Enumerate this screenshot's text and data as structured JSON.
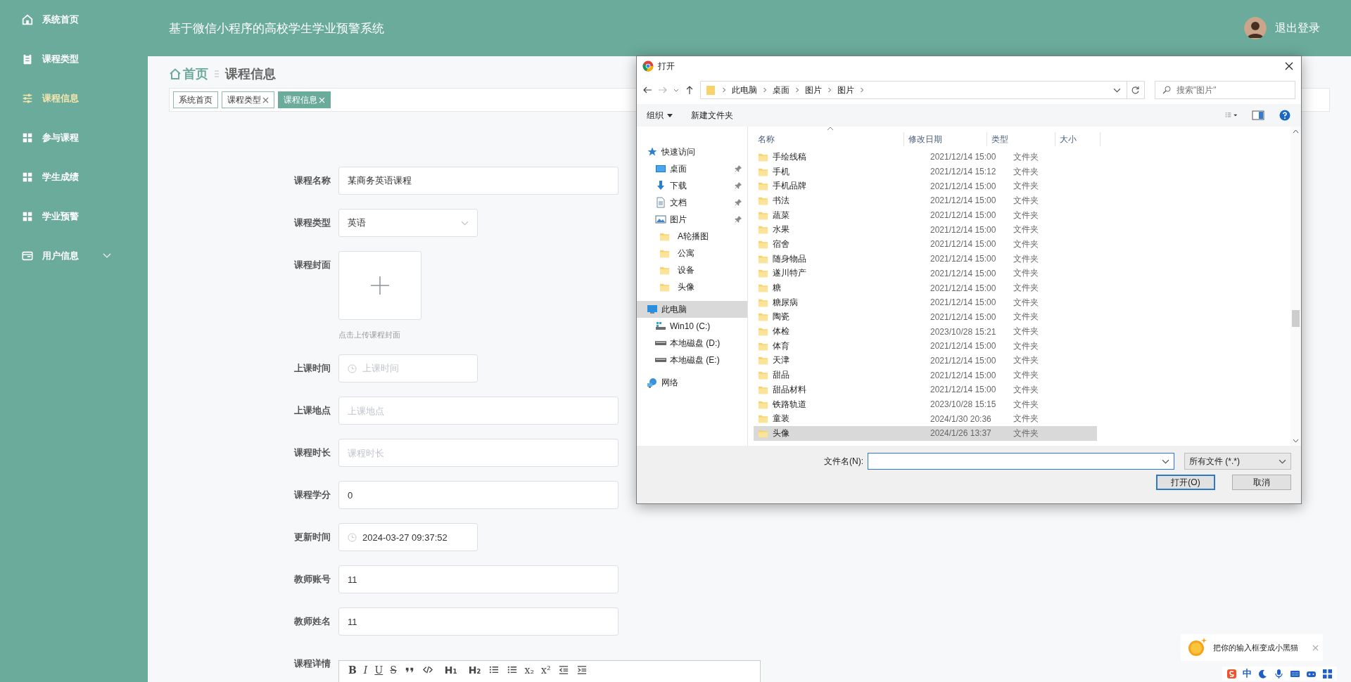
{
  "sidebar": {
    "items": [
      {
        "kind": "home",
        "label": "系统首页",
        "selected": false
      },
      {
        "kind": "clipboard",
        "label": "课程类型",
        "selected": false
      },
      {
        "kind": "sliders",
        "label": "课程信息",
        "selected": true
      },
      {
        "kind": "grid",
        "label": "参与课程",
        "selected": false
      },
      {
        "kind": "grid",
        "label": "学生成绩",
        "selected": false
      },
      {
        "kind": "grid",
        "label": "学业预警",
        "selected": false
      },
      {
        "kind": "card",
        "label": "用户信息",
        "selected": false,
        "expanded": false
      }
    ]
  },
  "header": {
    "title": "基于微信小程序的高校学生学业预警系统",
    "logout": "退出登录"
  },
  "breadcrumb": {
    "home": "首页",
    "current": "课程信息"
  },
  "tags": [
    {
      "label": "系统首页",
      "closable": false,
      "selected": false
    },
    {
      "label": "课程类型",
      "closable": true,
      "selected": false
    },
    {
      "label": "课程信息",
      "closable": true,
      "selected": true
    }
  ],
  "form": {
    "fields": [
      {
        "kind": "text",
        "label": "课程名称",
        "value": "某商务英语课程"
      },
      {
        "kind": "select",
        "label": "课程类型",
        "value": "英语"
      },
      {
        "kind": "upload",
        "label": "课程封面",
        "hint": "点击上传课程封面"
      },
      {
        "kind": "date",
        "label": "上课时间",
        "placeholder": "上课时间"
      },
      {
        "kind": "text",
        "label": "上课地点",
        "placeholder": "上课地点"
      },
      {
        "kind": "text",
        "label": "课程时长",
        "placeholder": "课程时长"
      },
      {
        "kind": "text",
        "label": "课程学分",
        "value": "0"
      },
      {
        "kind": "date",
        "label": "更新时间",
        "value": "2024-03-27 09:37:52"
      },
      {
        "kind": "text",
        "label": "教师账号",
        "value": "11"
      },
      {
        "kind": "text",
        "label": "教师姓名",
        "value": "11"
      },
      {
        "kind": "editor",
        "label": "课程详情",
        "toolbar": [
          {
            "kind": "bold",
            "label": "B"
          },
          {
            "kind": "italic",
            "label": "I"
          },
          {
            "kind": "underline",
            "label": "U"
          },
          {
            "kind": "strike",
            "label": "S"
          },
          {
            "kind": "quote"
          },
          {
            "kind": "code"
          },
          {
            "kind": "header",
            "label": "H₁"
          },
          {
            "kind": "header",
            "label": "H₂"
          },
          {
            "kind": "ordered-list"
          },
          {
            "kind": "bullet-list"
          },
          {
            "kind": "script",
            "label": "x₂"
          },
          {
            "kind": "script",
            "label": "x²"
          },
          {
            "kind": "outdent"
          },
          {
            "kind": "indent"
          }
        ]
      }
    ]
  },
  "file_dialog": {
    "title": "打开",
    "path": [
      "此电脑",
      "桌面",
      "图片",
      "图片"
    ],
    "search": {
      "placeholder": "搜索\"图片\""
    },
    "organize": "组织",
    "new_folder": "新建文件夹",
    "nav": [
      {
        "kind": "star",
        "label": "快速访问",
        "selected": false,
        "children": [
          {
            "kind": "desktop",
            "label": "桌面",
            "pinned": true,
            "selected": false
          },
          {
            "kind": "download",
            "label": "下载",
            "pinned": true,
            "selected": false
          },
          {
            "kind": "document",
            "label": "文档",
            "pinned": true,
            "selected": false
          },
          {
            "kind": "pictures",
            "label": "图片",
            "pinned": true,
            "selected": false
          },
          {
            "kind": "folder",
            "label": "A轮播图",
            "pinned": false,
            "selected": false
          },
          {
            "kind": "folder",
            "label": "公寓",
            "pinned": false,
            "selected": false
          },
          {
            "kind": "folder",
            "label": "设备",
            "pinned": false,
            "selected": false
          },
          {
            "kind": "folder",
            "label": "头像",
            "pinned": false,
            "selected": false
          }
        ]
      },
      {
        "kind": "computer",
        "label": "此电脑",
        "selected": true,
        "children": [
          {
            "kind": "system-drive",
            "label": "Win10 (C:)",
            "selected": false
          },
          {
            "kind": "drive",
            "label": "本地磁盘 (D:)",
            "selected": false
          },
          {
            "kind": "drive",
            "label": "本地磁盘 (E:)",
            "selected": false
          }
        ]
      },
      {
        "kind": "network",
        "label": "网络",
        "selected": false
      }
    ],
    "columns": [
      "名称",
      "修改日期",
      "类型",
      "大小"
    ],
    "rows": [
      {
        "name": "手绘线稿",
        "date": "2021/12/14 15:00",
        "type": "文件夹",
        "selected": false
      },
      {
        "name": "手机",
        "date": "2021/12/14 15:12",
        "type": "文件夹",
        "selected": false
      },
      {
        "name": "手机品牌",
        "date": "2021/12/14 15:00",
        "type": "文件夹",
        "selected": false
      },
      {
        "name": "书法",
        "date": "2021/12/14 15:00",
        "type": "文件夹",
        "selected": false
      },
      {
        "name": "蔬菜",
        "date": "2021/12/14 15:00",
        "type": "文件夹",
        "selected": false
      },
      {
        "name": "水果",
        "date": "2021/12/14 15:00",
        "type": "文件夹",
        "selected": false
      },
      {
        "name": "宿舍",
        "date": "2021/12/14 15:00",
        "type": "文件夹",
        "selected": false
      },
      {
        "name": "随身物品",
        "date": "2021/12/14 15:00",
        "type": "文件夹",
        "selected": false
      },
      {
        "name": "遂川特产",
        "date": "2021/12/14 15:00",
        "type": "文件夹",
        "selected": false
      },
      {
        "name": "糖",
        "date": "2021/12/14 15:00",
        "type": "文件夹",
        "selected": false
      },
      {
        "name": "糖尿病",
        "date": "2021/12/14 15:00",
        "type": "文件夹",
        "selected": false
      },
      {
        "name": "陶瓷",
        "date": "2021/12/14 15:00",
        "type": "文件夹",
        "selected": false
      },
      {
        "name": "体检",
        "date": "2023/10/28 15:21",
        "type": "文件夹",
        "selected": false
      },
      {
        "name": "体育",
        "date": "2021/12/14 15:00",
        "type": "文件夹",
        "selected": false
      },
      {
        "name": "天津",
        "date": "2021/12/14 15:00",
        "type": "文件夹",
        "selected": false
      },
      {
        "name": "甜品",
        "date": "2021/12/14 15:00",
        "type": "文件夹",
        "selected": false
      },
      {
        "name": "甜品材料",
        "date": "2021/12/14 15:00",
        "type": "文件夹",
        "selected": false
      },
      {
        "name": "铁路轨道",
        "date": "2023/10/28 15:15",
        "type": "文件夹",
        "selected": false
      },
      {
        "name": "童装",
        "date": "2024/1/30 20:36",
        "type": "文件夹",
        "selected": false
      },
      {
        "name": "头像",
        "date": "2024/1/26 13:37",
        "type": "文件夹",
        "selected": true
      }
    ],
    "filename_label": "文件名(N):",
    "filter": "所有文件 (*.*)",
    "buttons": [
      {
        "label": "打开(O)",
        "default": true
      },
      {
        "label": "取消",
        "default": false
      }
    ]
  },
  "ime": {
    "tip": "把你的输入框变成小黑猫",
    "mode": "中"
  }
}
